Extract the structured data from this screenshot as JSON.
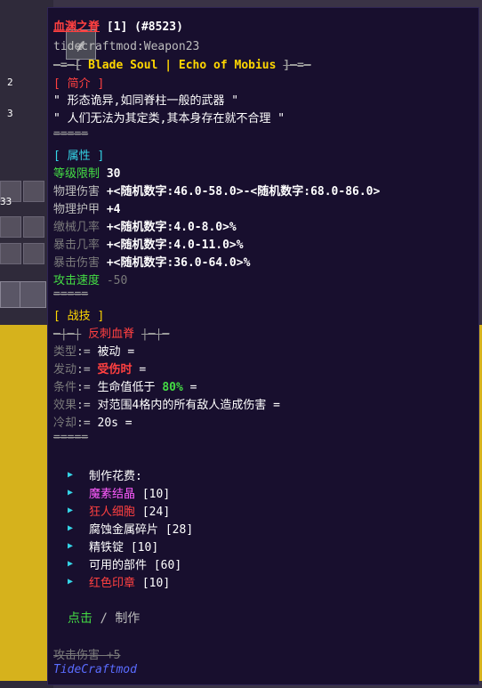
{
  "background": {
    "counts": [
      "2",
      "3"
    ],
    "stack_count": "33"
  },
  "tooltip": {
    "item_name": "血渊之脊",
    "item_count": "[1]",
    "item_id": "(#8523)",
    "internal_name": "tidecraftmod:Weapon23",
    "subtitle_prefix": "─=─[",
    "subtitle": "Blade Soul | Echo of Mobius",
    "subtitle_suffix": "]─=─",
    "intro_header": "[ 简介 ]",
    "lore_1": "\" 形态诡异,如同脊柱一般的武器 \"",
    "lore_2": "\" 人们无法为其定类,其本身存在就不合理 \"",
    "divider": "=====",
    "attr_header": "[ 属性 ]",
    "attrs": [
      {
        "label": "等级限制",
        "value": "30"
      },
      {
        "label": "物理伤害",
        "value": "+<随机数字:46.0-58.0>-<随机数字:68.0-86.0>"
      },
      {
        "label": "物理护甲",
        "value": "+4"
      },
      {
        "label": "缴械几率",
        "value": "+<随机数字:4.0-8.0>%"
      },
      {
        "label": "暴击几率",
        "value": "+<随机数字:4.0-11.0>%"
      },
      {
        "label": "暴击伤害",
        "value": "+<随机数字:36.0-64.0>%"
      },
      {
        "label": "攻击速度",
        "value": "-50"
      }
    ],
    "skill_header": "[ 战技 ]",
    "skill_prefix": "─|─|",
    "skill_name": "反刺血脊",
    "skill_suffix": "|─|─",
    "skill_rows": [
      {
        "key": "类型",
        "sep": ":=",
        "value": "被动 ="
      },
      {
        "key": "发动",
        "sep": ":=",
        "value_red": "受伤时",
        "value": "="
      },
      {
        "key": "条件",
        "sep": ":=",
        "value": "生命值低于",
        "value_green": "80%",
        "value_tail": "="
      },
      {
        "key": "效果",
        "sep": ":=",
        "value": "对范围4格内的所有敌人造成伤害  ="
      },
      {
        "key": "冷却",
        "sep": ":=",
        "value": "20s ="
      }
    ],
    "craft_header": "制作花费:",
    "materials": [
      {
        "name": "魔素结晶",
        "count": "[10]",
        "color": "#ff5cff"
      },
      {
        "name": "狂人细胞",
        "count": "[24]",
        "color": "#ff4040"
      },
      {
        "name": "腐蚀金属碎片",
        "count": "[28]",
        "color": "#e8e8e8"
      },
      {
        "name": "精铁锭",
        "count": "[10]",
        "color": "#e8e8e8"
      },
      {
        "name": "可用的部件",
        "count": "[60]",
        "color": "#e8e8e8"
      },
      {
        "name": "红色印章",
        "count": "[10]",
        "color": "#ff4040"
      }
    ],
    "click_label": "点击",
    "slash": "/",
    "craft_label": "制作",
    "overlap_text": "攻击伤害 +5",
    "mod_name": "TideCraftmod"
  }
}
